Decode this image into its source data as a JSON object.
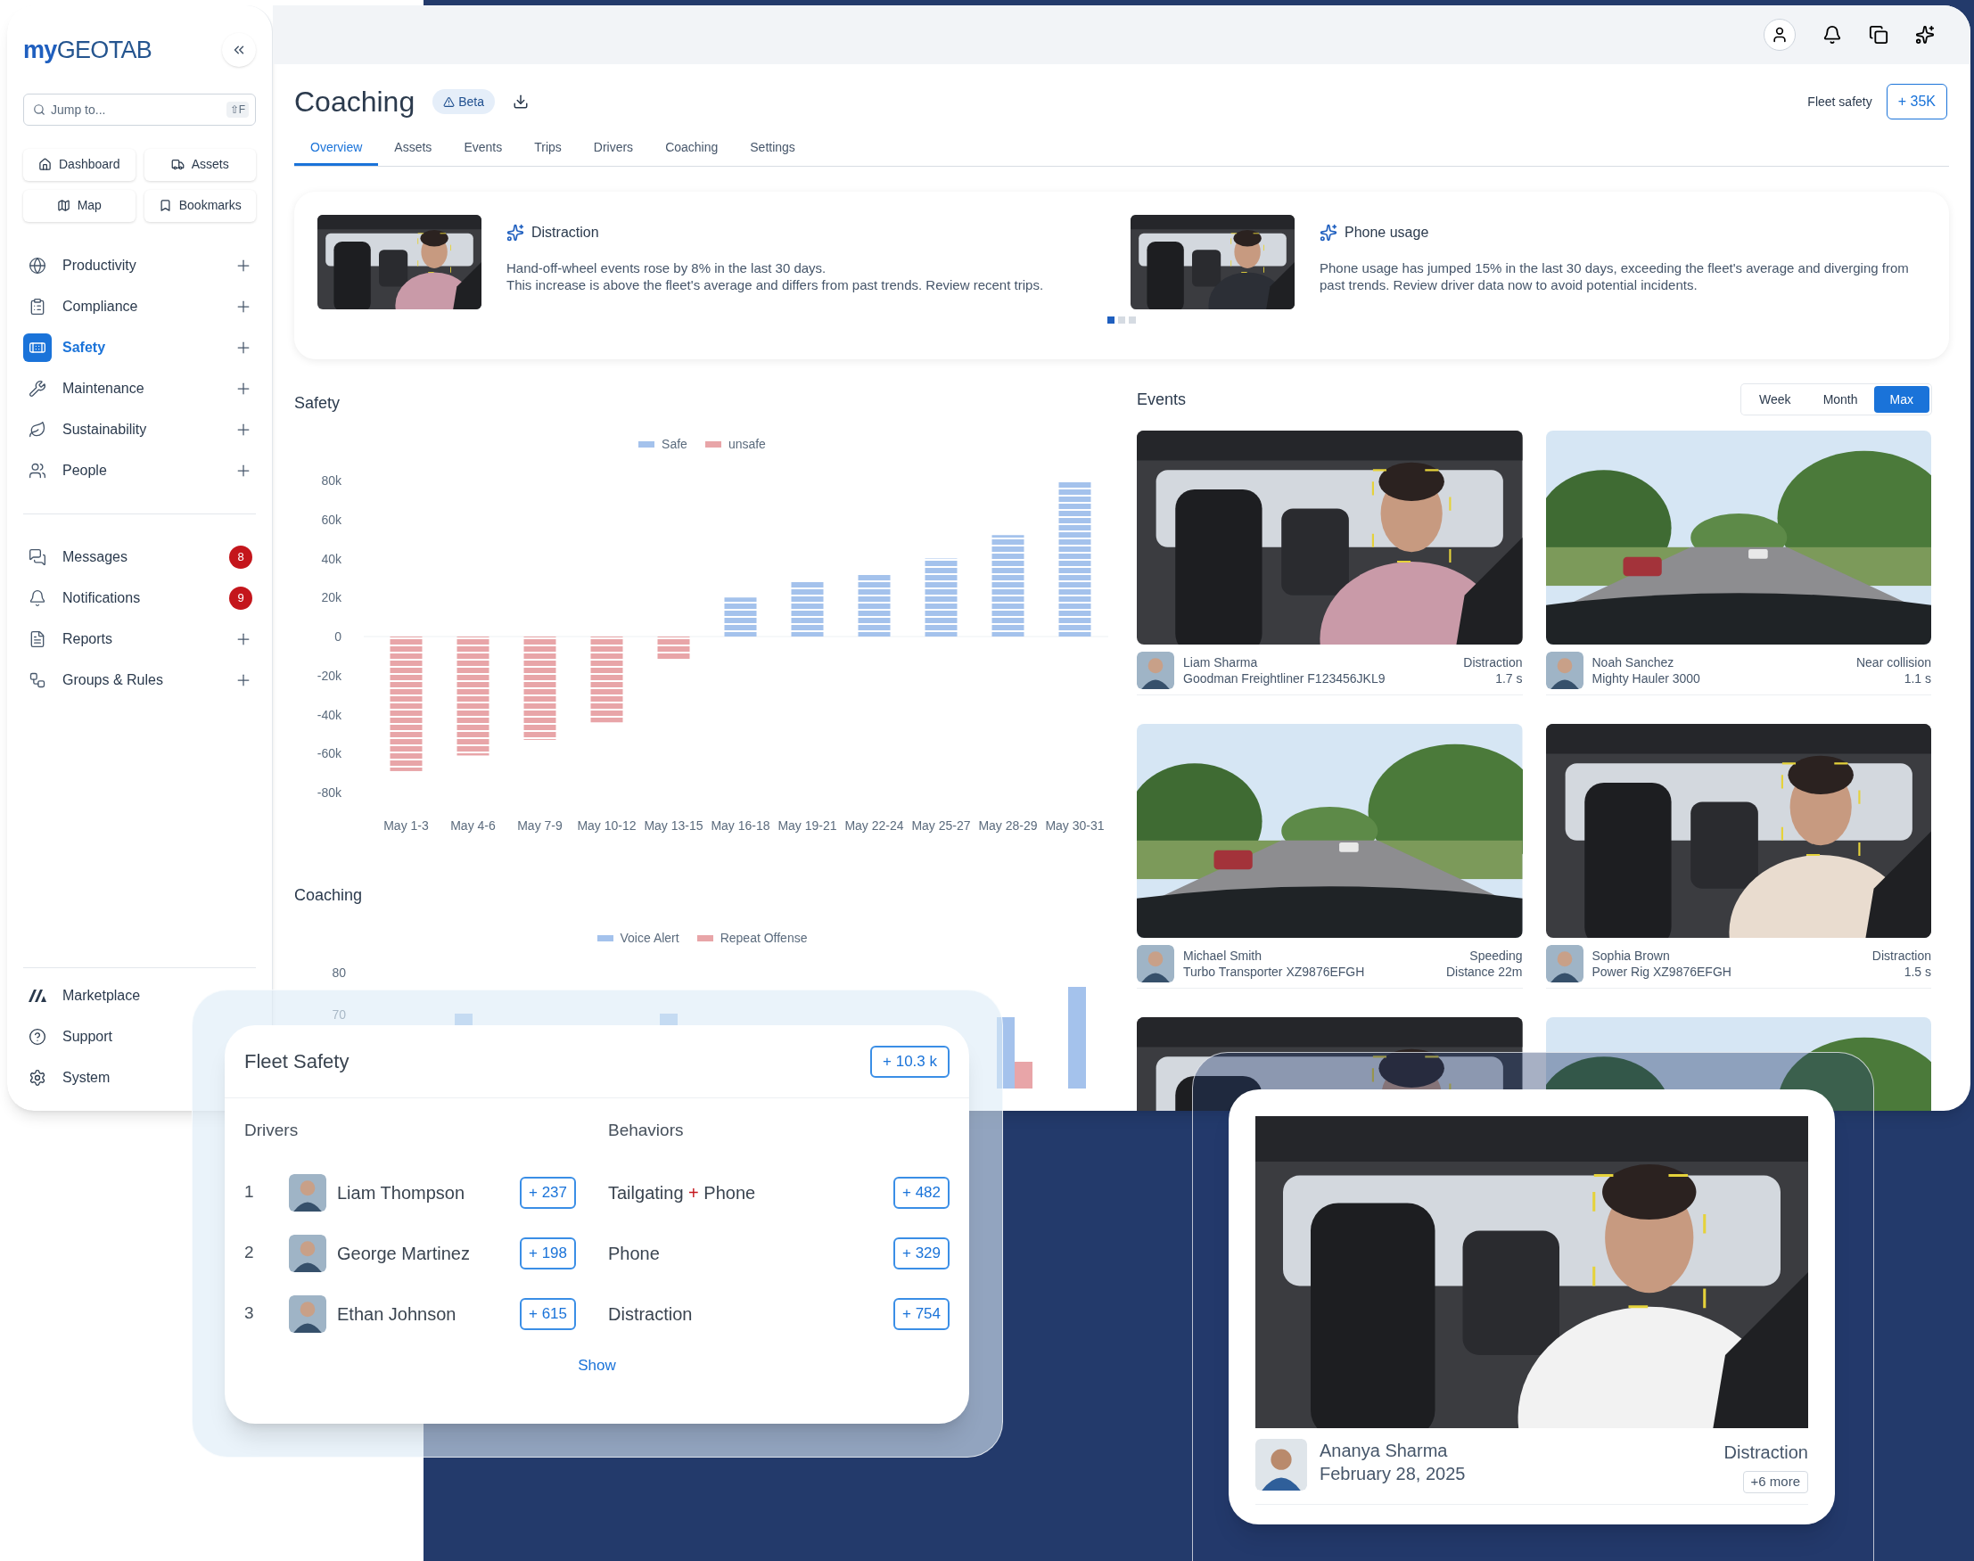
{
  "sidebar": {
    "logo": {
      "prefix": "my",
      "name": "GEOTAB"
    },
    "search": {
      "placeholder": "Jump to...",
      "shortcut": "⇧F"
    },
    "quick_links": [
      "Dashboard",
      "Assets",
      "Map",
      "Bookmarks"
    ],
    "items": [
      {
        "label": "Productivity",
        "kind": "expandable",
        "selected": false
      },
      {
        "label": "Compliance",
        "kind": "expandable",
        "selected": false
      },
      {
        "label": "Safety",
        "kind": "expandable",
        "selected": true
      },
      {
        "label": "Maintenance",
        "kind": "expandable",
        "selected": false
      },
      {
        "label": "Sustainability",
        "kind": "expandable",
        "selected": false
      },
      {
        "label": "People",
        "kind": "expandable",
        "selected": false
      }
    ],
    "items_2": [
      {
        "label": "Messages",
        "kind": "badge",
        "count": "8",
        "selected": false
      },
      {
        "label": "Notifications",
        "kind": "badge",
        "count": "9",
        "selected": false
      },
      {
        "label": "Reports",
        "kind": "expandable",
        "selected": false
      },
      {
        "label": "Groups & Rules",
        "kind": "expandable",
        "selected": false
      }
    ],
    "footer": [
      "Marketplace",
      "Support",
      "System"
    ]
  },
  "header": {
    "title": "Coaching",
    "badge": "Beta",
    "right_label": "Fleet safety",
    "right_button": "+ 35K"
  },
  "tabs": [
    {
      "label": "Overview",
      "selected": true
    },
    {
      "label": "Assets",
      "selected": false
    },
    {
      "label": "Events",
      "selected": false
    },
    {
      "label": "Trips",
      "selected": false
    },
    {
      "label": "Drivers",
      "selected": false
    },
    {
      "label": "Coaching",
      "selected": false
    },
    {
      "label": "Settings",
      "selected": false
    }
  ],
  "insights": [
    {
      "title": "Distraction",
      "lines": [
        "Hand-off-wheel events rose by 8% in the last 30 days.",
        "This increase is above the fleet's average and differs from past trends. Review recent trips."
      ]
    },
    {
      "title": "Phone usage",
      "lines": [
        "Phone usage has jumped 15% in the last 30 days, exceeding the fleet's average and diverging from past trends. Review driver data now to avoid potential incidents."
      ]
    }
  ],
  "pager": [
    {
      "selected": true
    },
    {
      "selected": false
    },
    {
      "selected": false
    }
  ],
  "safety": {
    "title": "Safety",
    "chart_data": {
      "type": "bar",
      "stacked": true,
      "legend": "top",
      "categories": [
        "May 1-3",
        "May 4-6",
        "May 7-9",
        "May 10-12",
        "May 13-15",
        "May 16-18",
        "May 19-21",
        "May 22-24",
        "May 25-27",
        "May 28-29",
        "May 30-31"
      ],
      "series": [
        {
          "name": "Safe",
          "color": "#a4c2ec",
          "values": [
            null,
            null,
            null,
            null,
            null,
            20000,
            28000,
            32000,
            40000,
            52000,
            80000
          ]
        },
        {
          "name": "unsafe",
          "color": "#e8a5a8",
          "values": [
            -69000,
            -61000,
            -53000,
            -44000,
            -12000,
            null,
            null,
            null,
            null,
            null,
            null
          ]
        }
      ],
      "ylim": [
        -80000,
        80000
      ],
      "yticks": [
        {
          "value": 80000,
          "label": "80k"
        },
        {
          "value": 60000,
          "label": "60k"
        },
        {
          "value": 40000,
          "label": "40k"
        },
        {
          "value": 20000,
          "label": "20k"
        },
        {
          "value": 0,
          "label": "0"
        },
        {
          "value": -20000,
          "label": "-20k"
        },
        {
          "value": -40000,
          "label": "-40k"
        },
        {
          "value": -60000,
          "label": "-60k"
        },
        {
          "value": -80000,
          "label": "-80k"
        }
      ]
    }
  },
  "coaching": {
    "title": "Coaching",
    "legend": [
      {
        "label": "Voice Alert",
        "color": "#a4c2ec"
      },
      {
        "label": "Repeat Offense",
        "color": "#e8a5a8"
      }
    ],
    "ticks": [
      "80",
      "70"
    ]
  },
  "events": {
    "title": "Events",
    "ranges": [
      {
        "label": "Week",
        "selected": false
      },
      {
        "label": "Month",
        "selected": false
      },
      {
        "label": "Max",
        "selected": true
      }
    ],
    "cards": [
      {
        "name": "Liam Sharma",
        "vehicle": "Goodman Freightliner F123456JKL9",
        "type": "Distraction",
        "detail": "1.7 s"
      },
      {
        "name": "Noah Sanchez",
        "vehicle": "Mighty Hauler 3000",
        "type": "Near collision",
        "detail": "1.1 s"
      },
      {
        "name": "Michael Smith",
        "vehicle": "Turbo Transporter XZ9876EFGH",
        "type": "Speeding",
        "detail": "Distance 22m"
      },
      {
        "name": "Sophia Brown",
        "vehicle": "Power Rig XZ9876EFGH",
        "type": "Distraction",
        "detail": "1.5 s"
      }
    ]
  },
  "fleet_safety": {
    "title": "Fleet Safety",
    "badge": "+ 10.3 k",
    "drivers_heading": "Drivers",
    "behaviors_heading": "Behaviors",
    "drivers": [
      {
        "rank": "1",
        "name": "Liam Thompson",
        "count": "+ 237"
      },
      {
        "rank": "2",
        "name": "George Martinez",
        "count": "+ 198"
      },
      {
        "rank": "3",
        "name": "Ethan Johnson",
        "count": "+ 615"
      }
    ],
    "behaviors": [
      {
        "parts": [
          {
            "text": "Tailgating",
            "kind": "plain"
          },
          {
            "text": "+",
            "kind": "accent"
          },
          {
            "text": "Phone",
            "kind": "plain"
          }
        ],
        "count": "+ 482"
      },
      {
        "parts": [
          {
            "text": "Phone",
            "kind": "plain"
          }
        ],
        "count": "+ 329"
      },
      {
        "parts": [
          {
            "text": "Distraction",
            "kind": "plain"
          }
        ],
        "count": "+ 754"
      }
    ],
    "link": "Show"
  },
  "event_highlight": {
    "name": "Ananya Sharma",
    "date": "February 28, 2025",
    "type": "Distraction",
    "more": "+6 more"
  }
}
